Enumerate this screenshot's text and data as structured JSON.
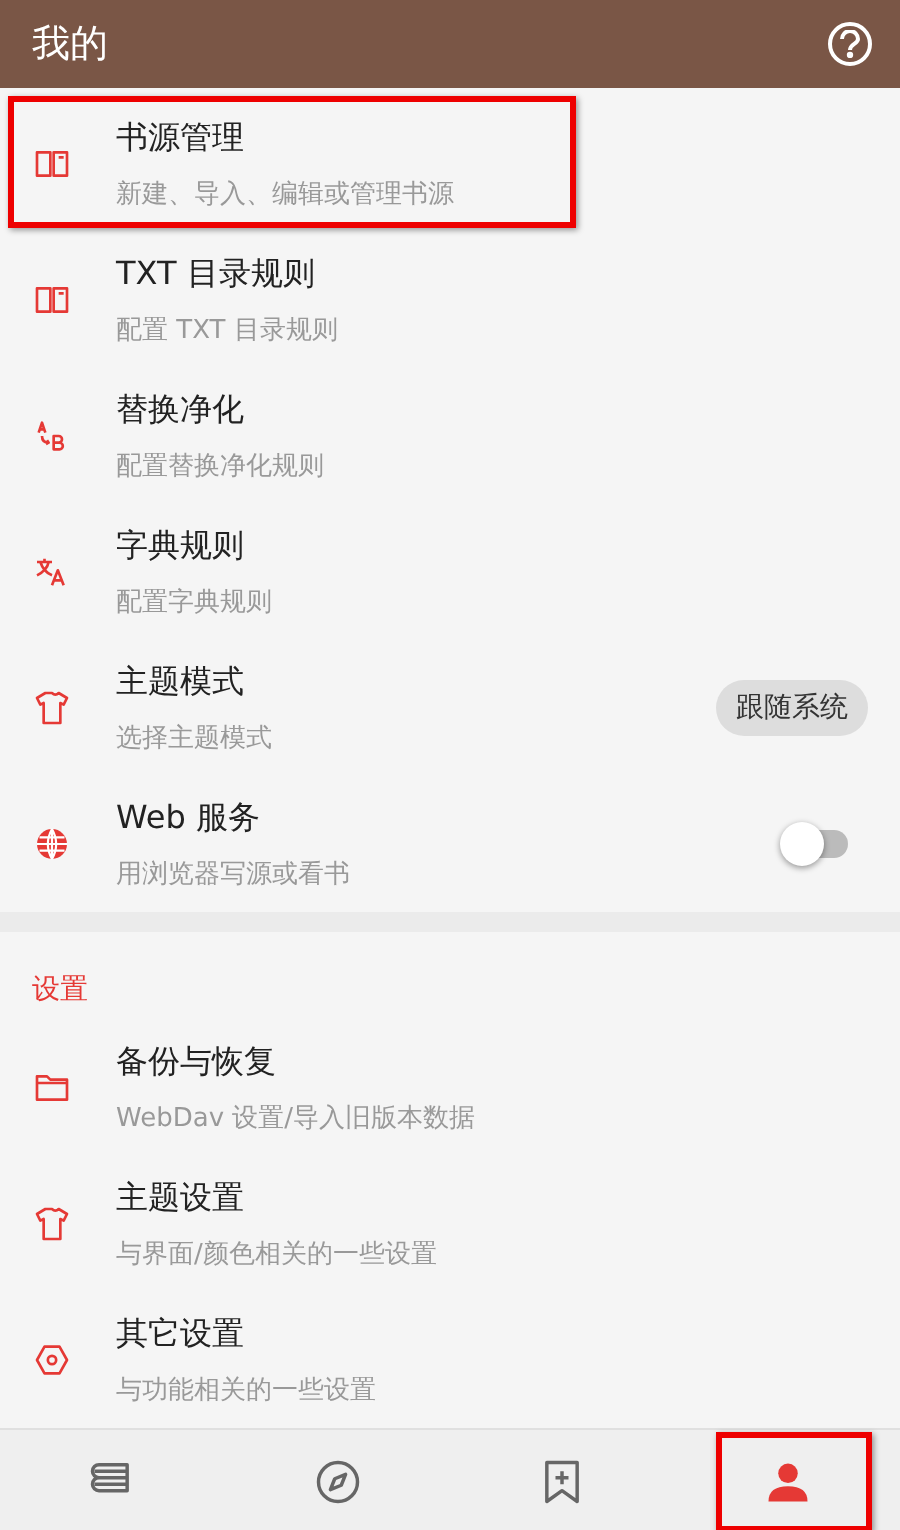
{
  "header": {
    "title": "我的"
  },
  "items": [
    {
      "kind": "plain",
      "title": "书源管理",
      "subtitle": "新建、导入、编辑或管理书源",
      "highlighted": true
    },
    {
      "kind": "plain",
      "title": "TXT 目录规则",
      "subtitle": "配置 TXT 目录规则",
      "highlighted": false
    },
    {
      "kind": "plain",
      "title": "替换净化",
      "subtitle": "配置替换净化规则",
      "highlighted": false
    },
    {
      "kind": "plain",
      "title": "字典规则",
      "subtitle": "配置字典规则",
      "highlighted": false
    },
    {
      "kind": "chip",
      "title": "主题模式",
      "subtitle": "选择主题模式",
      "value": "跟随系统",
      "highlighted": false
    },
    {
      "kind": "switch",
      "title": "Web 服务",
      "subtitle": "用浏览器写源或看书",
      "on": false,
      "highlighted": false
    }
  ],
  "settings": {
    "heading": "设置",
    "items": [
      {
        "title": "备份与恢复",
        "subtitle": "WebDav 设置/导入旧版本数据"
      },
      {
        "title": "主题设置",
        "subtitle": "与界面/颜色相关的一些设置"
      },
      {
        "title": "其它设置",
        "subtitle": "与功能相关的一些设置"
      }
    ]
  },
  "nav": [
    {
      "selected": false,
      "highlighted": false
    },
    {
      "selected": false,
      "highlighted": false
    },
    {
      "selected": false,
      "highlighted": false
    },
    {
      "selected": true,
      "highlighted": true
    }
  ]
}
